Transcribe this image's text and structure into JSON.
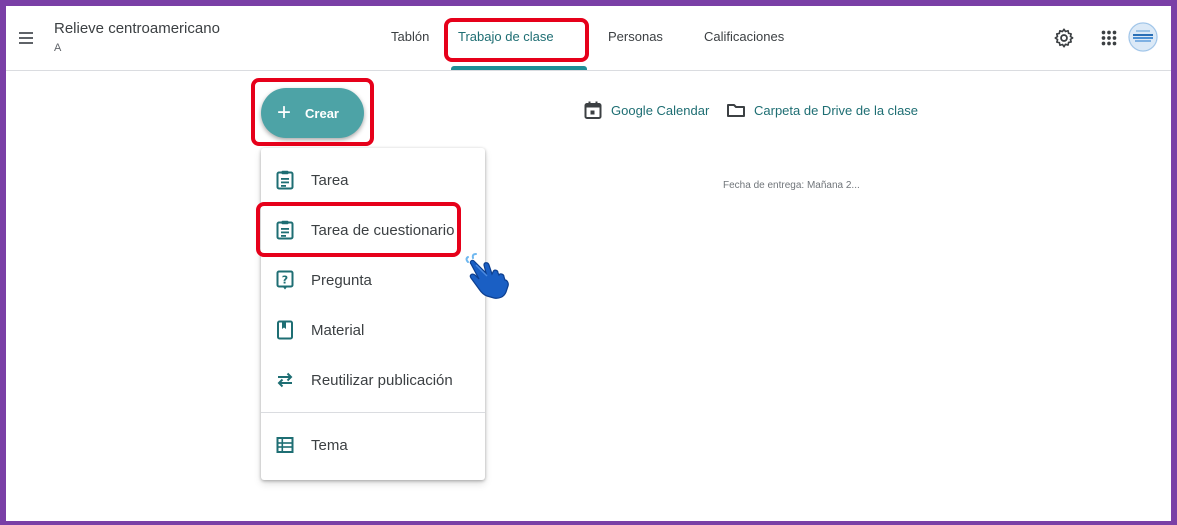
{
  "header": {
    "class_title": "Relieve centroamericano",
    "class_section": "A",
    "tabs": [
      {
        "label": "Tablón",
        "active": false
      },
      {
        "label": "Trabajo de clase",
        "active": true
      },
      {
        "label": "Personas",
        "active": false
      },
      {
        "label": "Calificaciones",
        "active": false
      }
    ],
    "icons": [
      "gear-icon",
      "apps-grid-icon",
      "avatar"
    ]
  },
  "create": {
    "label": "Crear",
    "icon": "plus-icon"
  },
  "menu": {
    "items": [
      {
        "label": "Tarea",
        "icon": "assignment-icon"
      },
      {
        "label": "Tarea de cuestionario",
        "icon": "quiz-assignment-icon"
      },
      {
        "label": "Pregunta",
        "icon": "question-icon"
      },
      {
        "label": "Material",
        "icon": "material-icon"
      },
      {
        "label": "Reutilizar publicación",
        "icon": "reuse-icon"
      },
      {
        "label": "Tema",
        "icon": "topic-icon"
      }
    ]
  },
  "links": {
    "calendar": "Google Calendar",
    "drive": "Carpeta de Drive de la clase"
  },
  "due_text": "Fecha de entrega: Mañana 2...",
  "colors": {
    "accent": "#1e8e96",
    "create_button": "#4da3a6",
    "highlight": "#e6001a",
    "frame": "#7a3fa6"
  }
}
